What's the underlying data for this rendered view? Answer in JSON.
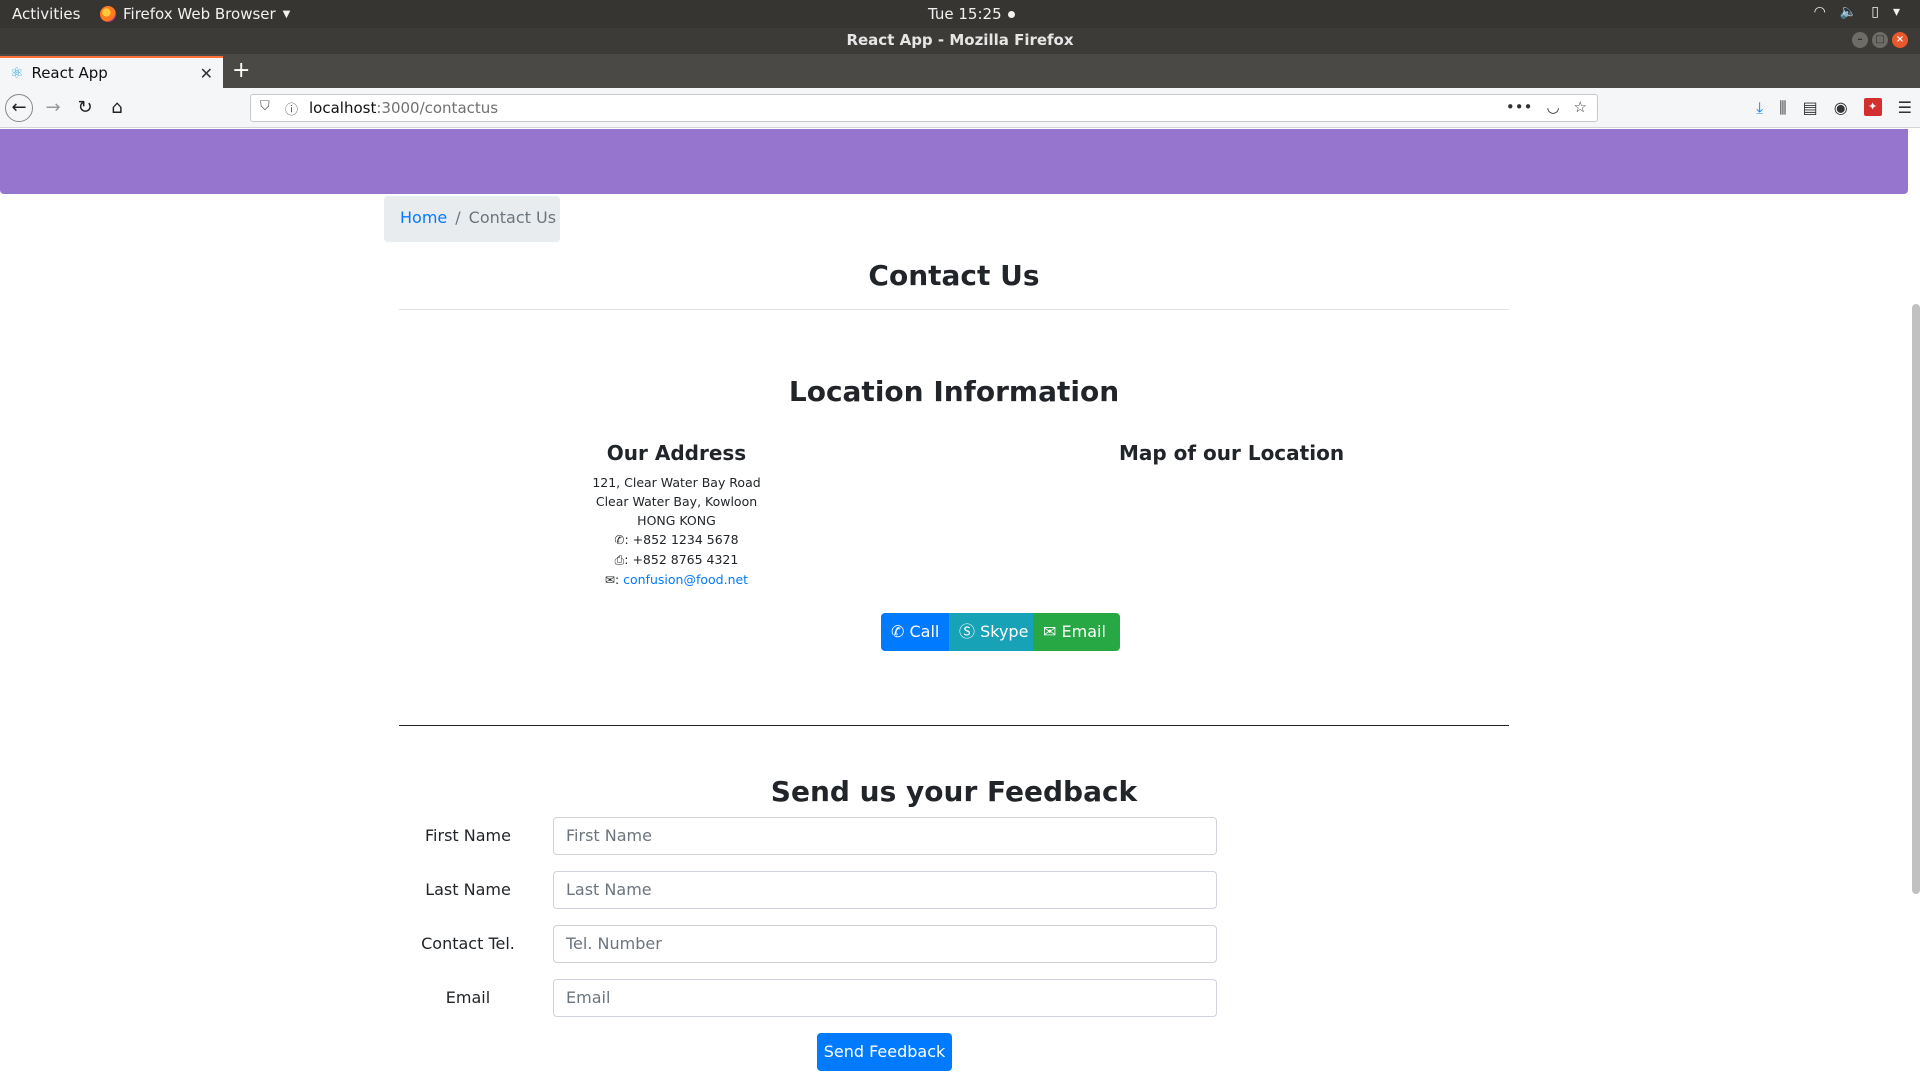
{
  "system_bar": {
    "activities": "Activities",
    "app_name": "Firefox Web Browser",
    "clock": "Tue 15:25"
  },
  "window": {
    "title": "React App - Mozilla Firefox"
  },
  "browser": {
    "tab_title": "React App",
    "url_host": "localhost",
    "url_path": ":3000/contactus"
  },
  "breadcrumb": {
    "home": "Home",
    "separator": "/",
    "current": "Contact Us"
  },
  "page": {
    "title": "Contact Us",
    "location_heading": "Location Information",
    "address_heading": "Our Address",
    "map_heading": "Map of our Location"
  },
  "address": {
    "line1": "121, Clear Water Bay Road",
    "line2": "Clear Water Bay, Kowloon",
    "line3": "HONG KONG",
    "phone": "+852 1234 5678",
    "fax": "+852 8765 4321",
    "email": "confusion@food.net"
  },
  "actions": {
    "call": "Call",
    "skype": "Skype",
    "email": "Email"
  },
  "feedback": {
    "heading": "Send us your Feedback",
    "first_name_label": "First Name",
    "first_name_placeholder": "First Name",
    "last_name_label": "Last Name",
    "last_name_placeholder": "Last Name",
    "tel_label": "Contact Tel.",
    "tel_placeholder": "Tel. Number",
    "email_label": "Email",
    "email_placeholder": "Email",
    "submit": "Send Feedback"
  },
  "colors": {
    "header_band": "#9575cd",
    "primary": "#007bff",
    "info": "#17a2b8",
    "success": "#28a745"
  }
}
